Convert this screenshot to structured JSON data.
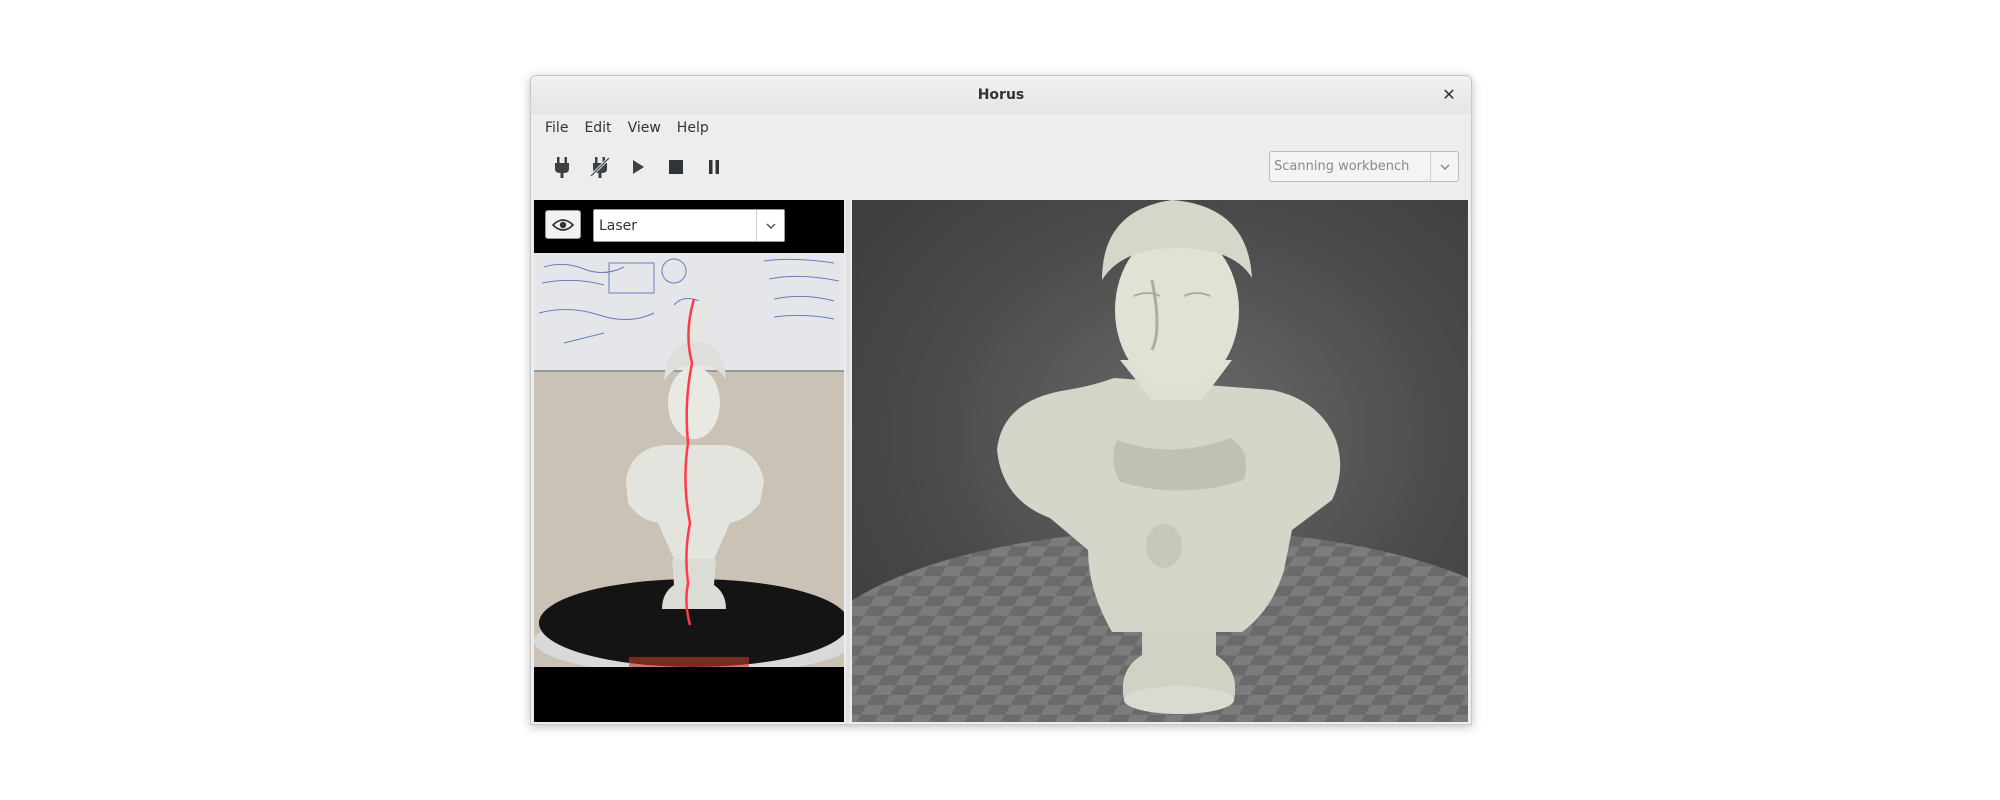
{
  "window": {
    "title": "Horus"
  },
  "menu": {
    "items": [
      "File",
      "Edit",
      "View",
      "Help"
    ]
  },
  "toolbar": {
    "buttons": [
      {
        "icon": "plug-connect-icon"
      },
      {
        "icon": "plug-disconnect-icon"
      },
      {
        "icon": "play-icon"
      },
      {
        "icon": "stop-icon"
      },
      {
        "icon": "pause-icon"
      }
    ],
    "workbench_select": {
      "value": "Scanning workbench"
    }
  },
  "camera_panel": {
    "view_mode": {
      "value": "Laser"
    }
  },
  "colors": {
    "laser_line": "#ff3b4a",
    "scene_bg": "#4a4a4a",
    "point_cloud": "#d8dcd0"
  }
}
